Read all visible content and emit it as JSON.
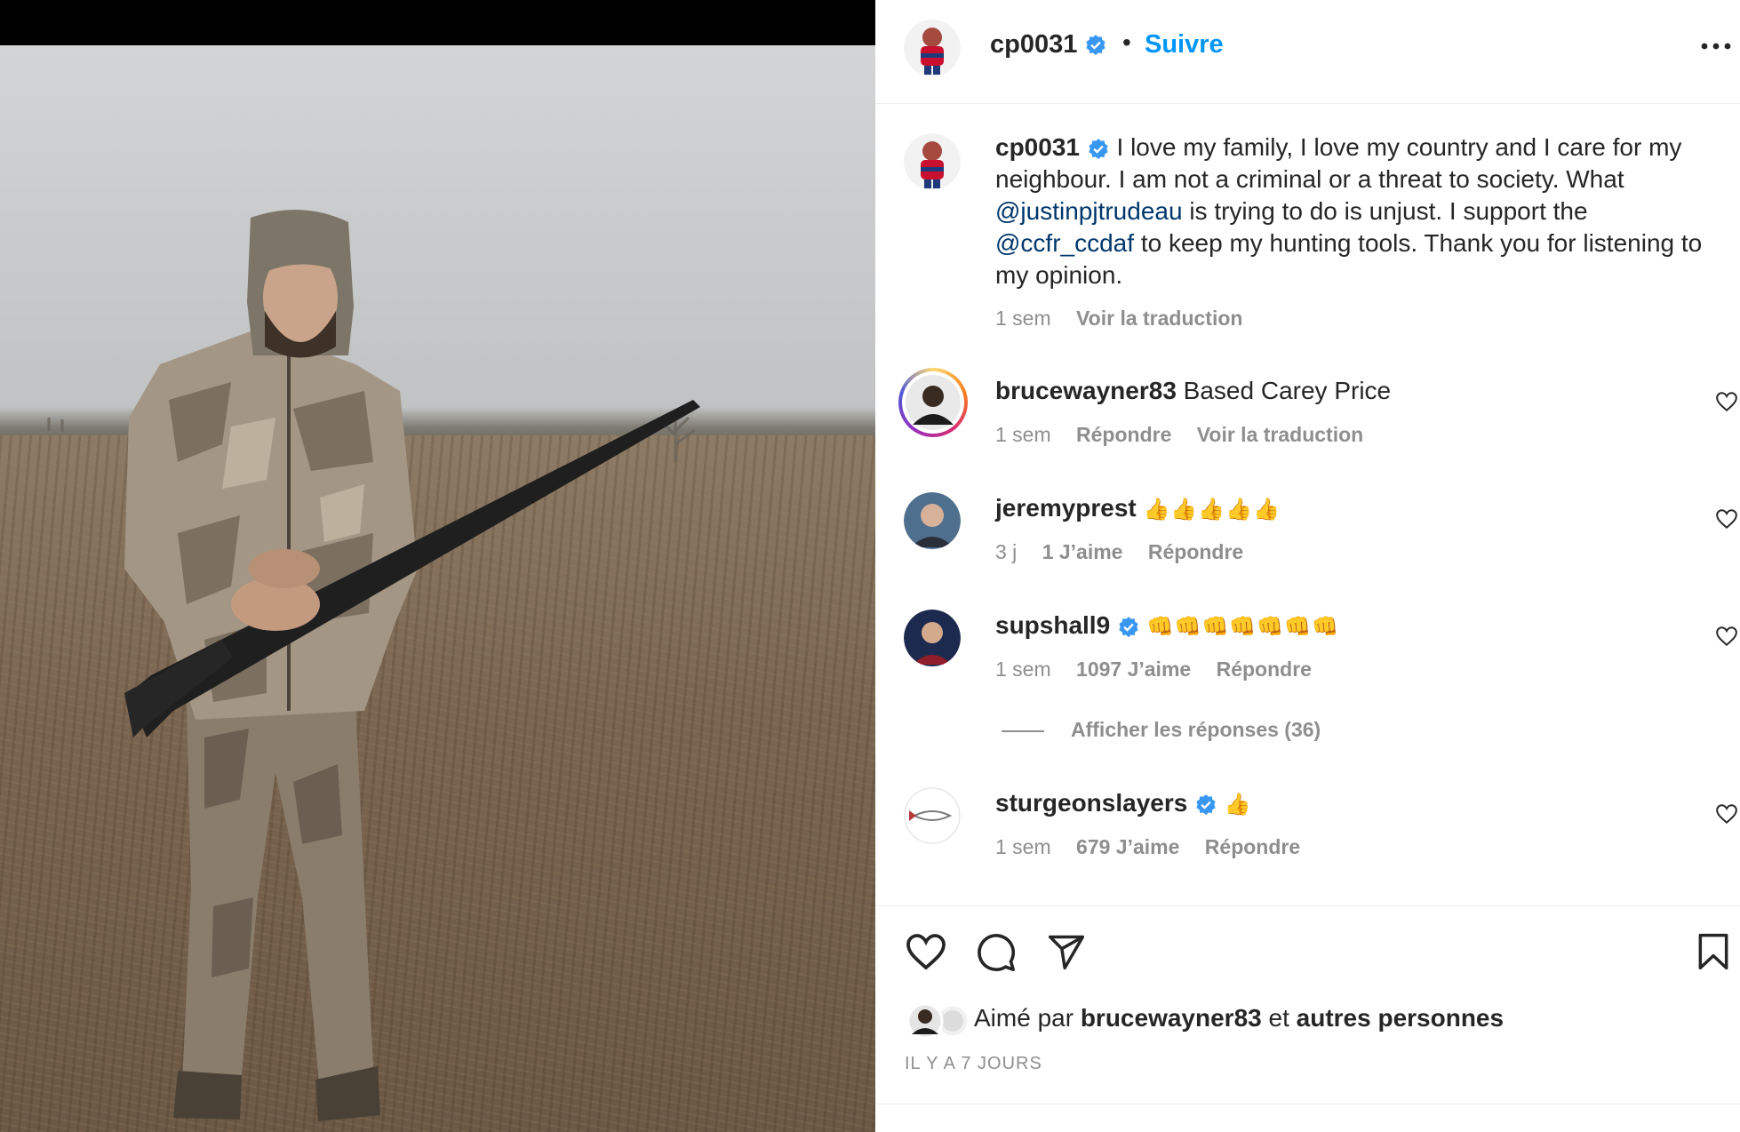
{
  "post": {
    "author": "cp0031",
    "verified": true,
    "separator": "•",
    "follow_label": "Suivre"
  },
  "caption": {
    "username": "cp0031",
    "text_1": "I love my family, I love my country and I care for my neighbour. I am not a criminal or a threat to society. What",
    "mention_1": "@justinpjtrudeau",
    "text_2": "is trying to do is unjust. I support the",
    "mention_2": "@ccfr_ccdaf",
    "text_3": "to keep my hunting tools. Thank you for listening to my opinion.",
    "time": "1 sem",
    "translate_label": "Voir la traduction"
  },
  "comments": [
    {
      "username": "brucewayner83",
      "text": "Based Carey Price",
      "time": "1 sem",
      "reply": "Répondre",
      "translate": "Voir la traduction"
    },
    {
      "username": "jeremyprest",
      "emoji": "👍👍👍👍👍",
      "time": "3 j",
      "likes": "1 J’aime",
      "reply": "Répondre"
    },
    {
      "username": "supshall9",
      "verified": true,
      "emoji": "👊👊👊👊👊👊👊",
      "time": "1 sem",
      "likes": "1097 J’aime",
      "reply": "Répondre"
    },
    {
      "username": "sturgeonslayers",
      "verified": true,
      "emoji": "👍",
      "time": "1 sem",
      "likes": "679 J’aime",
      "reply": "Répondre"
    }
  ],
  "replies_label": "Afficher les réponses (36)",
  "likes": {
    "prefix": "Aimé par",
    "user": "brucewayner83",
    "connector": "et",
    "others": "autres personnes"
  },
  "date": "IL Y A 7 JOURS",
  "icons": [
    "verified-badge-icon",
    "more-options-icon",
    "heart-icon",
    "comment-icon",
    "share-icon",
    "bookmark-icon"
  ],
  "colors": {
    "link": "#0095f6",
    "mention": "#00376b",
    "verified": "#3897f0",
    "muted": "#8e8e8e"
  }
}
